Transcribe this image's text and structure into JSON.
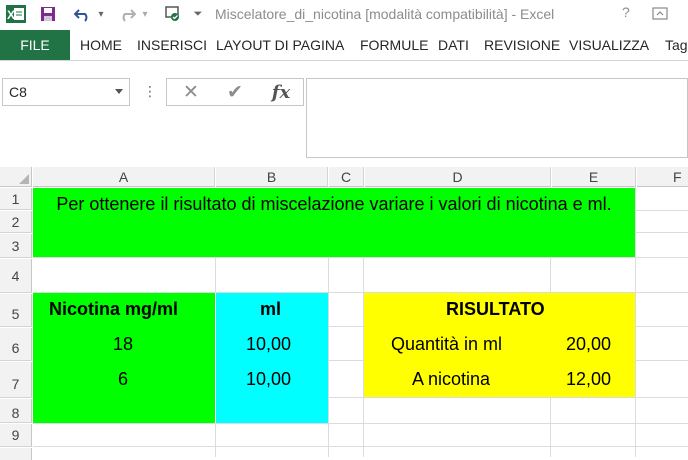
{
  "titlebar": {
    "title": "Miscelatore_di_nicotina  [modalità compatibilità] - Excel",
    "help": "?",
    "icons": [
      "excel-logo-icon",
      "save-icon",
      "undo-icon",
      "redo-icon",
      "touch-mode-icon",
      "customize-qat-icon",
      "restore-window-icon"
    ]
  },
  "ribbon": {
    "file": "FILE",
    "tabs": [
      "HOME",
      "INSERISCI",
      "LAYOUT DI PAGINA",
      "FORMULE",
      "DATI",
      "REVISIONE",
      "VISUALIZZA",
      "Tag"
    ]
  },
  "formula_bar": {
    "name_box": "C8",
    "fx": "fx",
    "formula": ""
  },
  "columns": [
    "A",
    "B",
    "C",
    "D",
    "E",
    "F"
  ],
  "rows": [
    "1",
    "2",
    "3",
    "4",
    "5",
    "6",
    "7",
    "8",
    "9"
  ],
  "cells": {
    "banner": "Per ottenere il risultato di miscelazione variare i valori di nicotina e ml.",
    "a5": "Nicotina mg/ml",
    "b5": "ml",
    "a6": "18",
    "b6": "10,00",
    "a7": "6",
    "b7": "10,00",
    "d5": "RISULTATO",
    "d6": "Quantità in ml",
    "e6": "20,00",
    "d7": "A nicotina",
    "e7": "12,00"
  },
  "colors": {
    "excel_green": "#217346",
    "green_fill": "#00ff00",
    "cyan_fill": "#00ffff",
    "yellow_fill": "#ffff00"
  }
}
